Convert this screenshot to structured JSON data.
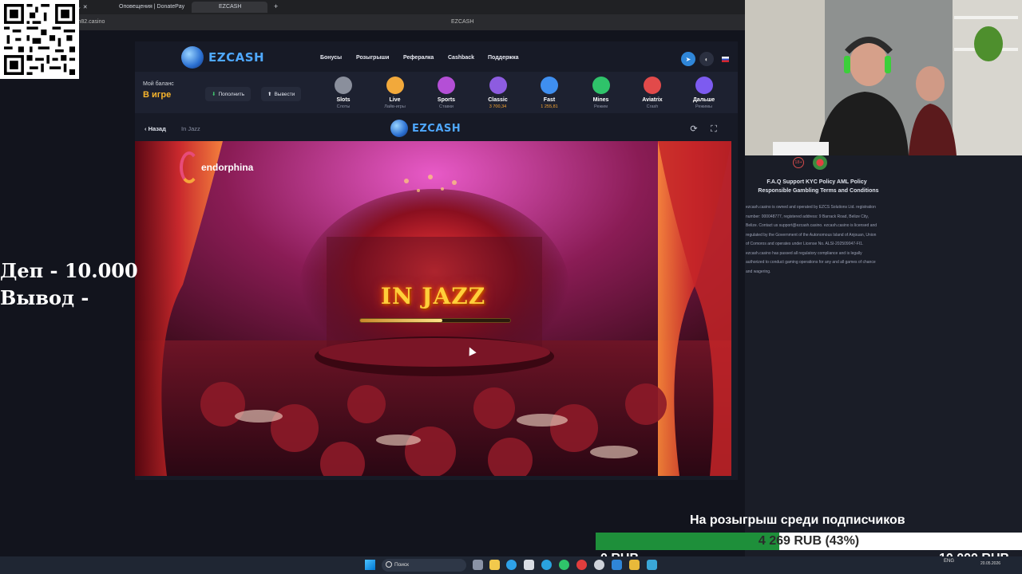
{
  "browser": {
    "tabs": [
      {
        "label": "Оповещения | DonatePay"
      },
      {
        "label": "EZCASH"
      }
    ],
    "new_tab": "+",
    "url": "sh82.casino",
    "window_title": "EZCASH"
  },
  "site": {
    "brand": "EZCASH",
    "nav": [
      "Бонусы",
      "Розыгрыши",
      "Рефералка",
      "Cashback",
      "Поддержка"
    ],
    "balance_label": "Мой баланс",
    "balance_value": "В игре",
    "deposit_button": "Пополнить",
    "withdraw_button": "Вывести",
    "categories": [
      {
        "name": "Slots",
        "sub": "Слоты",
        "color": "#8a8f9c",
        "icon": "slot-icon"
      },
      {
        "name": "Live",
        "sub": "Лайв-игры",
        "color": "#f2a93b",
        "icon": "live-icon"
      },
      {
        "name": "Sports",
        "sub": "Ставки",
        "color": "#b44fd6",
        "icon": "sports-icon"
      },
      {
        "name": "Classic",
        "sub": "3 700,34",
        "color": "#8d5ce0",
        "icon": "classic-icon"
      },
      {
        "name": "Fast",
        "sub": "1 255,81",
        "color": "#3f8ff0",
        "icon": "fast-icon"
      },
      {
        "name": "Mines",
        "sub": "Режим",
        "color": "#2fc36a",
        "icon": "mines-icon"
      },
      {
        "name": "Aviatrix",
        "sub": "Crash",
        "color": "#e24a4a",
        "icon": "aviatrix-icon"
      },
      {
        "name": "Дальше",
        "sub": "Режимы",
        "color": "#7d5bf0",
        "icon": "next-icon"
      }
    ],
    "back_label": "Назад",
    "game_crumb": "In Jazz"
  },
  "game": {
    "provider": "endorphina",
    "title": "IN JAZZ",
    "loading_fraction": 0.55
  },
  "overlay": {
    "dep_line": "Деп - 10.000",
    "withdraw_line": "Вывод -"
  },
  "footer": {
    "age": "18+",
    "links_row1": "F.A.Q  Support  KYC Policy  AML Policy",
    "links_row2": "Responsible Gambling  Terms and Conditions",
    "legal": "ezcash.casino is owned and operated by EZCS Solutions Ltd. registration number: 000048777, registered address: 9 Barrack Road, Belize City, Belize. Contact us support@ezcash.casino. ezcash.casino is licensed and regulated by the Government of the Autonomous Island of Anjouan, Union of Comoros and operates under License No. ALSI-202509047-FI1. ezcash.casino has passed all regulatory compliance and is legally authorized to conduct gaming operations for any and all games of chance and wagering."
  },
  "donation": {
    "label": "На розыгрыш среди подписчиков",
    "amount_text": "4 269 RUB (43%)",
    "fraction": 0.43,
    "min": "0 RUB",
    "max": "10 000 RUB"
  },
  "taskbar": {
    "search_placeholder": "Поиск",
    "lang": "ENG",
    "date": "20.05.2026"
  }
}
